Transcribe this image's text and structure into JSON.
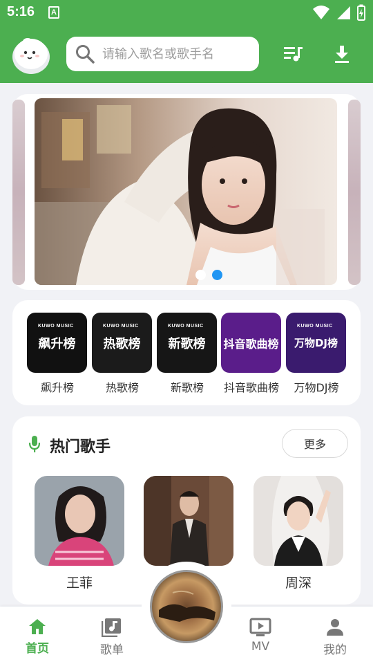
{
  "status_bar": {
    "time": "5:16",
    "notification_icon": "A"
  },
  "header": {
    "search_placeholder": "请输入歌名或歌手名",
    "playlist_icon": "queue-music-icon",
    "download_icon": "download-icon"
  },
  "banner": {
    "slide_count": 2,
    "active_index": 1
  },
  "charts": {
    "items": [
      {
        "label": "飙升榜",
        "cover_text": "飙升榜",
        "bg": "#111111"
      },
      {
        "label": "热歌榜",
        "cover_text": "热歌榜",
        "bg": "#1b1b1b"
      },
      {
        "label": "新歌榜",
        "cover_text": "新歌榜",
        "bg": "#161616"
      },
      {
        "label": "抖音歌曲榜",
        "cover_text": "抖音歌曲榜",
        "bg": "#5a1d8a"
      },
      {
        "label": "万物DJ榜",
        "cover_text": "万物DJ榜",
        "bg": "#3a1b6e"
      }
    ],
    "brand": "KUWO MUSIC"
  },
  "hot_singers": {
    "title": "热门歌手",
    "more_label": "更多",
    "singers": [
      {
        "name": "王菲"
      },
      {
        "name": ""
      },
      {
        "name": "周深"
      }
    ]
  },
  "bottom_nav": {
    "items": [
      {
        "label": "首页",
        "icon": "home-icon",
        "active": true
      },
      {
        "label": "歌单",
        "icon": "playlist-icon",
        "active": false
      },
      {
        "label": "MV",
        "icon": "tv-icon",
        "active": false
      },
      {
        "label": "我的",
        "icon": "person-icon",
        "active": false
      }
    ]
  },
  "colors": {
    "primary": "#4caf50",
    "dot_active": "#2196f3",
    "background": "#f1f2f6"
  }
}
